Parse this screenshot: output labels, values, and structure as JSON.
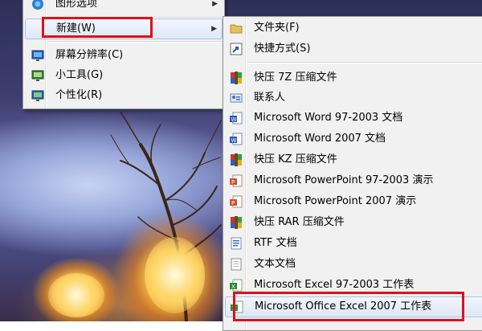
{
  "context_menu": {
    "items": [
      {
        "label": "图形选项",
        "icon": "graphics-icon"
      },
      {
        "label": "新建(W)",
        "icon": "",
        "submenu": true
      },
      {
        "label": "屏幕分辨率(C)",
        "icon": "monitor-icon"
      },
      {
        "label": "小工具(G)",
        "icon": "gadgets-icon"
      },
      {
        "label": "个性化(R)",
        "icon": "personalize-icon"
      }
    ]
  },
  "submenu": {
    "items": [
      {
        "label": "文件夹(F)",
        "icon": "folder-icon"
      },
      {
        "label": "快捷方式(S)",
        "icon": "shortcut-icon"
      },
      {
        "label": "快压 7Z 压缩文件",
        "icon": "archive-icon"
      },
      {
        "label": "联系人",
        "icon": "contact-icon"
      },
      {
        "label": "Microsoft Word 97-2003 文档",
        "icon": "word-doc-icon"
      },
      {
        "label": "Microsoft Word 2007 文档",
        "icon": "word-docx-icon"
      },
      {
        "label": "快压 KZ 压缩文件",
        "icon": "archive-icon"
      },
      {
        "label": "Microsoft PowerPoint 97-2003 演示",
        "icon": "powerpoint-icon"
      },
      {
        "label": "Microsoft PowerPoint 2007 演示",
        "icon": "powerpoint-icon"
      },
      {
        "label": "快压 RAR 压缩文件",
        "icon": "archive-icon"
      },
      {
        "label": "RTF 文档",
        "icon": "rtf-doc-icon"
      },
      {
        "label": "文本文档",
        "icon": "text-doc-icon"
      },
      {
        "label": "Microsoft Excel 97-2003 工作表",
        "icon": "excel-icon"
      },
      {
        "label": "Microsoft Office Excel 2007 工作表",
        "icon": "excel-icon"
      }
    ]
  },
  "colors": {
    "highlight_box": "#e0101a",
    "menu_bg": "#f1f1f1",
    "hover_border": "#a8c3e9"
  }
}
